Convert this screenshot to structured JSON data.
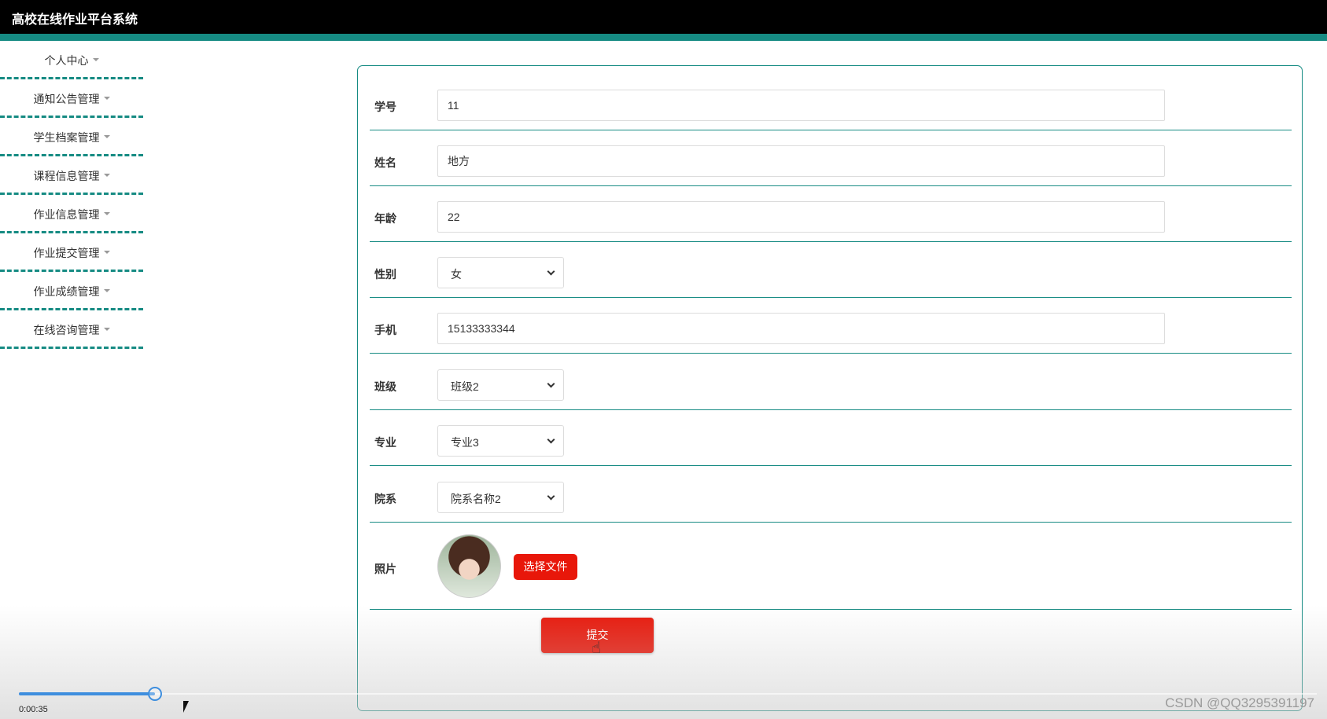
{
  "app": {
    "title": "高校在线作业平台系统"
  },
  "colors": {
    "accent": "#168b83",
    "topbar": "#000000",
    "button": "#e8170a",
    "progress": "#3e8ede"
  },
  "sidebar": {
    "items": [
      {
        "label": "个人中心"
      },
      {
        "label": "通知公告管理"
      },
      {
        "label": "学生档案管理"
      },
      {
        "label": "课程信息管理"
      },
      {
        "label": "作业信息管理"
      },
      {
        "label": "作业提交管理"
      },
      {
        "label": "作业成绩管理"
      },
      {
        "label": "在线咨询管理"
      }
    ]
  },
  "form": {
    "student_id": {
      "label": "学号",
      "value": "11"
    },
    "name": {
      "label": "姓名",
      "value": "地方"
    },
    "age": {
      "label": "年龄",
      "value": "22"
    },
    "gender": {
      "label": "性别",
      "value": "女"
    },
    "phone": {
      "label": "手机",
      "value": "15133333344"
    },
    "class": {
      "label": "班级",
      "value": "班级2"
    },
    "major": {
      "label": "专业",
      "value": "专业3"
    },
    "department": {
      "label": "院系",
      "value": "院系名称2"
    },
    "photo": {
      "label": "照片",
      "choose_file_label": "选择文件"
    },
    "submit_label": "提交"
  },
  "player": {
    "time": "0:00:35",
    "progress": 0.105
  },
  "watermark": "CSDN @QQ3295391197"
}
